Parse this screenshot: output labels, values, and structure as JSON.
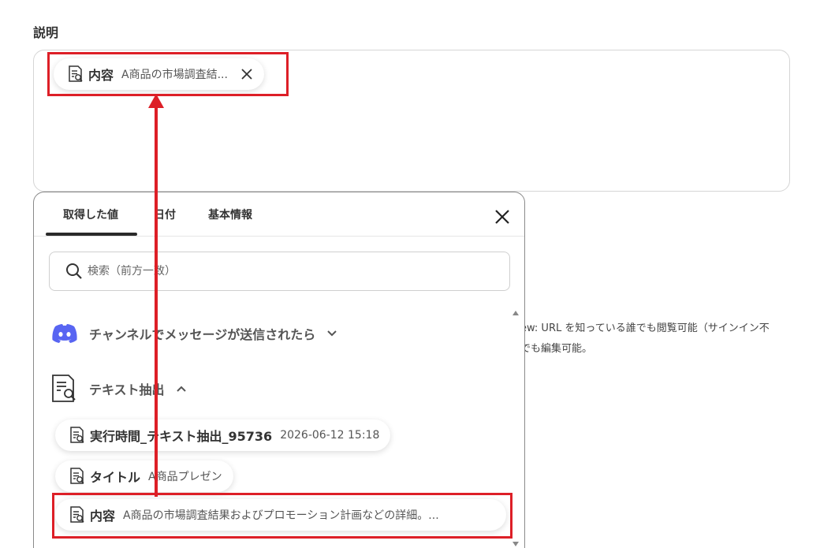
{
  "field": {
    "label": "説明"
  },
  "selected_chip": {
    "name": "内容",
    "value": "A商品の市場調査結..."
  },
  "background_text": {
    "line1": "ew: URL を知っている誰でも閲覧可能（サインイン不",
    "line2": "でも編集可能。"
  },
  "popup": {
    "tabs": [
      {
        "label": "取得した値",
        "active": true
      },
      {
        "label": "日付",
        "active": false
      },
      {
        "label": "基本情報",
        "active": false
      }
    ],
    "search": {
      "placeholder": "検索（前方一致）"
    },
    "groups": [
      {
        "label": "チャンネルでメッセージが送信されたら",
        "icon": "discord-icon",
        "chevron": "down"
      },
      {
        "label": "テキスト抽出",
        "icon": "document-search-icon",
        "chevron": "up"
      }
    ],
    "items": [
      {
        "name": "実行時間_テキスト抽出_95736",
        "value": "2026-06-12 15:18"
      },
      {
        "name": "タイトル",
        "value": "A商品プレゼン"
      },
      {
        "name": "内容",
        "value": "A商品の市場調査結果およびプロモーション計画などの詳細。..."
      }
    ]
  },
  "colors": {
    "highlight": "#dd1f27",
    "discord": "#5865f2"
  }
}
